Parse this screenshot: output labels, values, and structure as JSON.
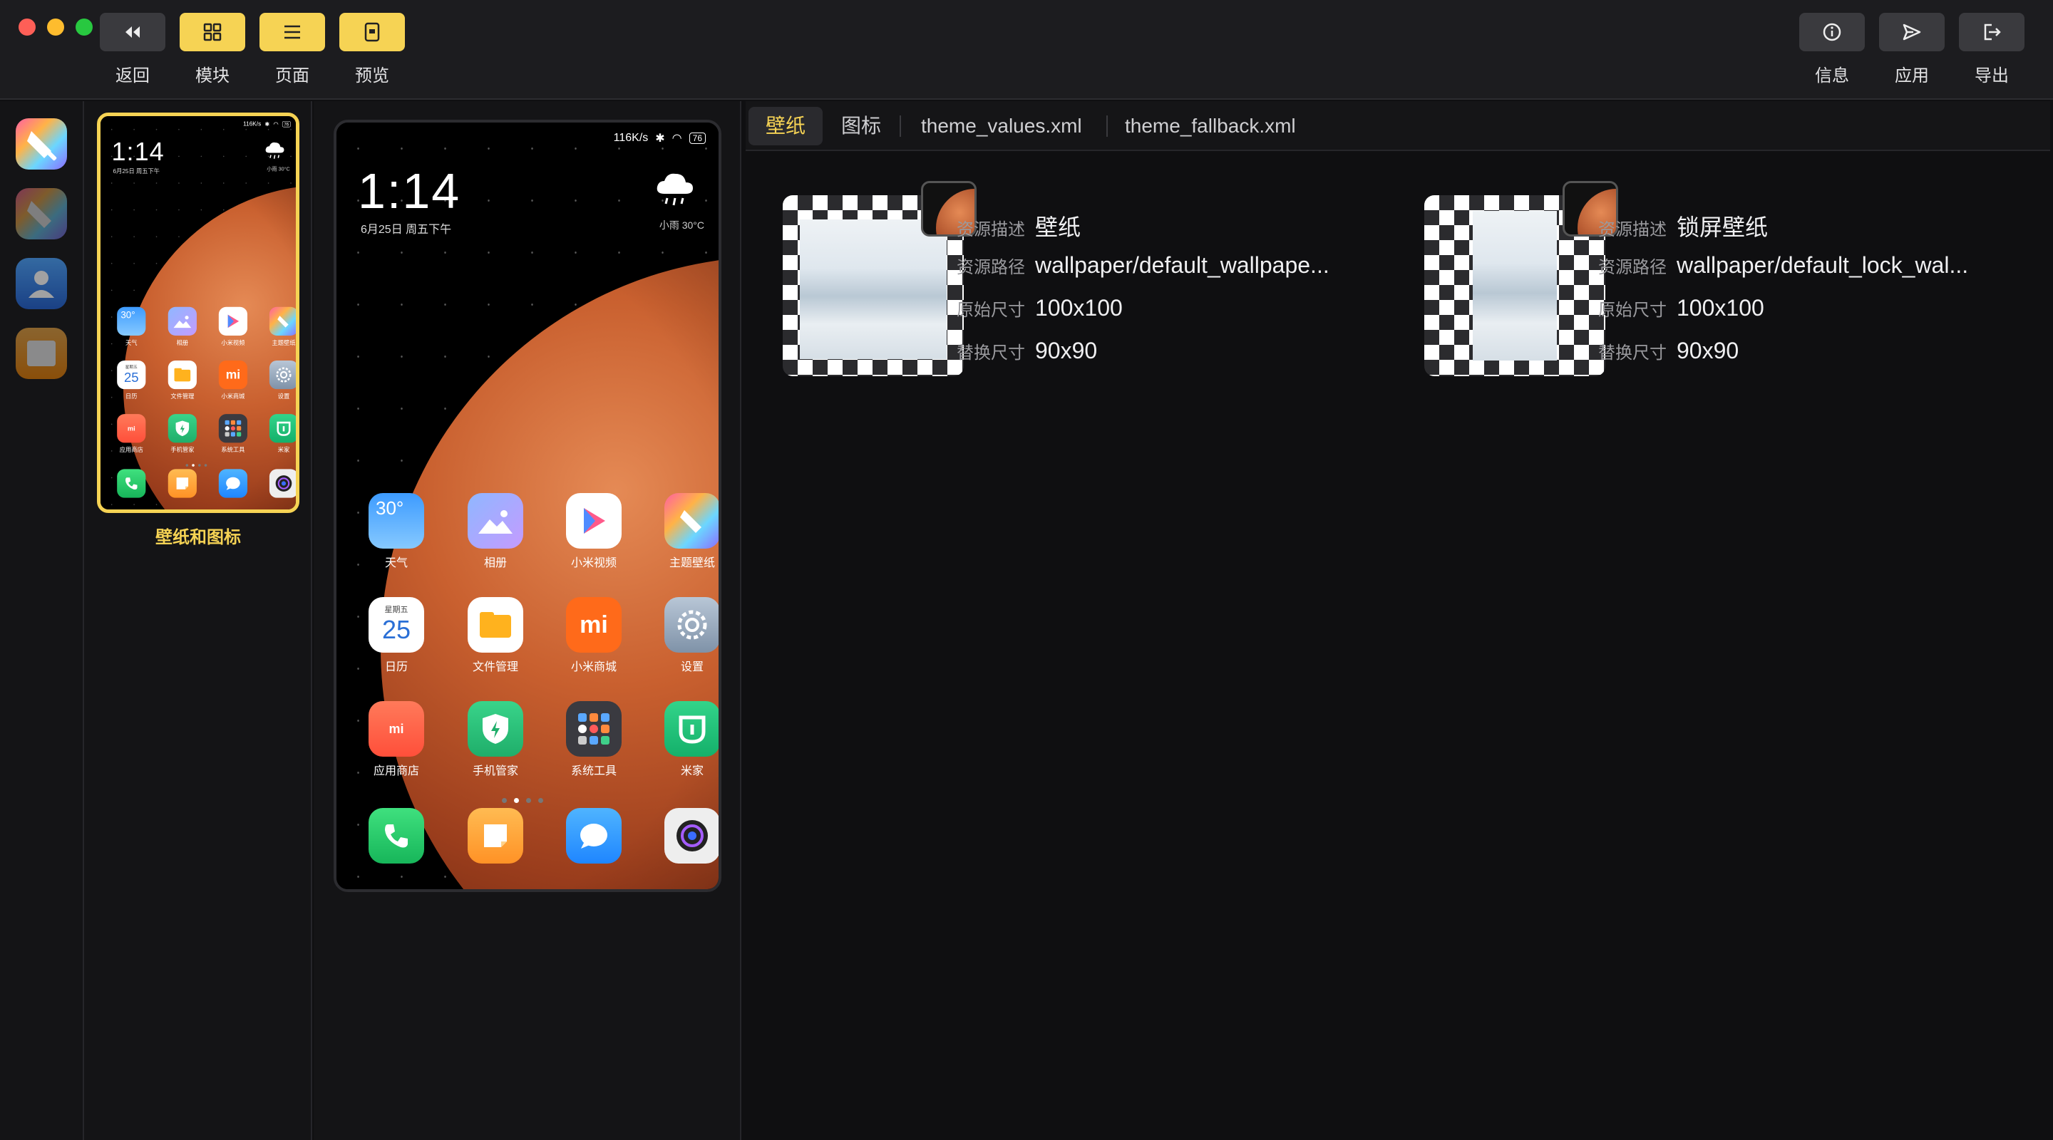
{
  "toolbar": {
    "traffic_colors": [
      "#fe5f57",
      "#febc2e",
      "#28c840"
    ],
    "left_buttons": [
      {
        "id": "back",
        "label": "返回",
        "icon": "rewind-icon"
      },
      {
        "id": "modules",
        "label": "模块",
        "icon": "grid-icon"
      },
      {
        "id": "pages",
        "label": "页面",
        "icon": "list-icon"
      },
      {
        "id": "preview",
        "label": "预览",
        "icon": "phone-icon"
      }
    ],
    "right_buttons": [
      {
        "id": "info",
        "label": "信息",
        "icon": "info-icon"
      },
      {
        "id": "apply",
        "label": "应用",
        "icon": "send-icon"
      },
      {
        "id": "export",
        "label": "导出",
        "icon": "export-icon"
      }
    ]
  },
  "sidebar": {
    "apps": [
      "theme-app-icon",
      "theme-app-dimmed-icon",
      "contacts-app-icon",
      "messages-app-icon"
    ]
  },
  "page_list": {
    "items": [
      {
        "label": "壁纸和图标",
        "selected": true
      }
    ]
  },
  "phone": {
    "status_speed": "116K/s",
    "battery": "76",
    "clock": "1:14",
    "date": "6月25日 周五下午",
    "weather": "小雨  30°C",
    "apps": [
      {
        "label": "天气",
        "icon": "weather-app-icon",
        "text": "30°"
      },
      {
        "label": "相册",
        "icon": "gallery-app-icon"
      },
      {
        "label": "小米视频",
        "icon": "video-app-icon"
      },
      {
        "label": "主题壁纸",
        "icon": "themes-app-icon"
      },
      {
        "label": "日历",
        "icon": "calendar-app-icon",
        "text": "25",
        "subtext": "星期五"
      },
      {
        "label": "文件管理",
        "icon": "files-app-icon"
      },
      {
        "label": "小米商城",
        "icon": "mi-store-app-icon",
        "text": "mi"
      },
      {
        "label": "设置",
        "icon": "settings-app-icon"
      },
      {
        "label": "应用商店",
        "icon": "app-store-app-icon",
        "text": "mi"
      },
      {
        "label": "手机管家",
        "icon": "security-app-icon"
      },
      {
        "label": "系统工具",
        "icon": "tools-folder-icon"
      },
      {
        "label": "米家",
        "icon": "mijia-app-icon"
      }
    ],
    "dock": [
      "phone-app-icon",
      "notes-app-icon",
      "messages-app-icon",
      "camera-app-icon"
    ]
  },
  "tabs": [
    {
      "label": "壁纸",
      "active": true
    },
    {
      "label": "图标",
      "active": false
    },
    {
      "label": "theme_values.xml",
      "active": false
    },
    {
      "label": "theme_fallback.xml",
      "active": false
    }
  ],
  "resources": [
    {
      "desc_key": "资源描述",
      "desc": "壁纸",
      "path_key": "资源路径",
      "path": "wallpaper/default_wallpape...",
      "orig_key": "原始尺寸",
      "orig": "100x100",
      "repl_key": "替换尺寸",
      "repl": "90x90"
    },
    {
      "desc_key": "资源描述",
      "desc": "锁屏壁纸",
      "path_key": "资源路径",
      "path": "wallpaper/default_lock_wal...",
      "orig_key": "原始尺寸",
      "orig": "100x100",
      "repl_key": "替换尺寸",
      "repl": "90x90"
    }
  ]
}
